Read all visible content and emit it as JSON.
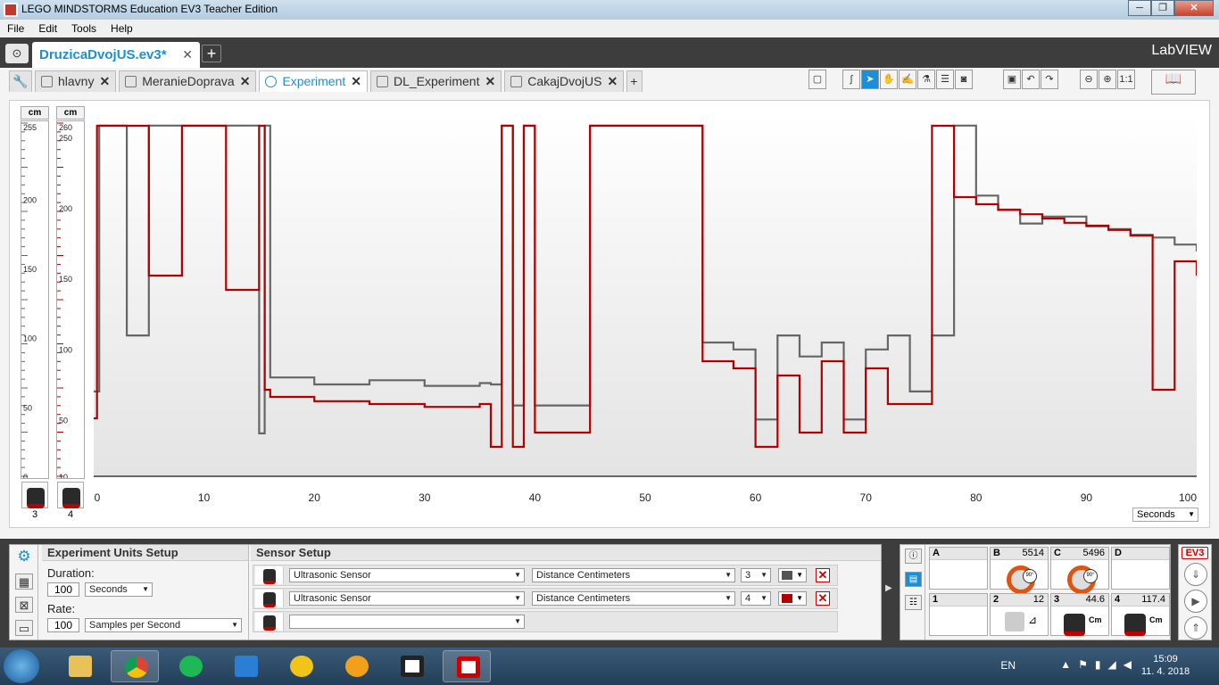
{
  "window": {
    "title": "LEGO MINDSTORMS Education EV3 Teacher Edition",
    "buttons": [
      "─",
      "❐",
      "✕"
    ]
  },
  "menu": [
    "File",
    "Edit",
    "Tools",
    "Help"
  ],
  "project": {
    "name": "DruzicaDvojUS.ev3*",
    "brand": "LabVIEW"
  },
  "program_tabs": [
    {
      "label": "hlavny"
    },
    {
      "label": "MeranieDoprava"
    },
    {
      "label": "Experiment"
    },
    {
      "label": "DL_Experiment"
    },
    {
      "label": "CakajDvojUS"
    }
  ],
  "chart": {
    "axis1": {
      "unit": "cm",
      "port": "3",
      "ticks": [
        "255",
        "200",
        "150",
        "100",
        "50",
        "0"
      ]
    },
    "axis2": {
      "unit": "cm",
      "port": "4",
      "ticks": [
        "260",
        "250",
        "200",
        "150",
        "100",
        "50",
        "10"
      ]
    },
    "time_unit": "Seconds"
  },
  "chart_data": {
    "type": "line",
    "xlabel": "Seconds",
    "xlim": [
      0,
      100
    ],
    "x_ticks": [
      0,
      10,
      20,
      30,
      40,
      50,
      60,
      70,
      80,
      90,
      100
    ],
    "series": [
      {
        "color": "#666666",
        "axis": "left",
        "ylim": [
          0,
          255
        ],
        "x": [
          0,
          0.5,
          1,
          2,
          3,
          5,
          10,
          14,
          15,
          15.5,
          16,
          20,
          25,
          30,
          35,
          36,
          37,
          38,
          39,
          40,
          45,
          50,
          55,
          55.2,
          58,
          60,
          62,
          64,
          66,
          68,
          70,
          72,
          74,
          76,
          78,
          80,
          82,
          84,
          86,
          88,
          90,
          92,
          94,
          96,
          98,
          100
        ],
        "y": [
          60,
          250,
          250,
          250,
          100,
          250,
          250,
          250,
          30,
          250,
          70,
          65,
          68,
          64,
          66,
          65,
          250,
          50,
          250,
          50,
          250,
          250,
          250,
          95,
          90,
          40,
          100,
          85,
          95,
          40,
          90,
          100,
          60,
          100,
          250,
          200,
          190,
          180,
          185,
          185,
          178,
          176,
          172,
          170,
          165,
          160
        ]
      },
      {
        "color": "#b00000",
        "axis": "right",
        "ylim": [
          10,
          260
        ],
        "x": [
          0,
          0.3,
          1,
          2,
          5,
          8,
          10,
          12,
          15,
          15.5,
          16,
          20,
          25,
          30,
          35,
          36,
          37,
          38,
          39,
          40,
          45,
          50,
          55,
          55.2,
          58,
          60,
          62,
          64,
          66,
          68,
          70,
          72,
          74,
          76,
          78,
          80,
          82,
          84,
          86,
          88,
          90,
          92,
          94,
          96,
          98,
          100
        ],
        "y": [
          50,
          255,
          255,
          255,
          150,
          255,
          255,
          140,
          255,
          70,
          65,
          62,
          60,
          58,
          60,
          30,
          255,
          30,
          255,
          40,
          255,
          255,
          255,
          90,
          85,
          30,
          80,
          40,
          90,
          40,
          85,
          60,
          60,
          255,
          205,
          200,
          196,
          193,
          190,
          187,
          185,
          182,
          178,
          70,
          160,
          150
        ]
      }
    ]
  },
  "experiment_setup": {
    "title": "Experiment Units Setup",
    "duration_label": "Duration:",
    "duration_value": "100",
    "duration_unit": "Seconds",
    "rate_label": "Rate:",
    "rate_value": "100",
    "rate_unit": "Samples per Second"
  },
  "sensor_setup": {
    "title": "Sensor Setup",
    "rows": [
      {
        "sensor": "Ultrasonic Sensor",
        "mode": "Distance Centimeters",
        "port": "3",
        "color": "#555555"
      },
      {
        "sensor": "Ultrasonic Sensor",
        "mode": "Distance Centimeters",
        "port": "4",
        "color": "#b00000"
      }
    ]
  },
  "hardware": {
    "ports": [
      {
        "port": "A",
        "value": ""
      },
      {
        "port": "B",
        "value": "5514"
      },
      {
        "port": "C",
        "value": "5496"
      },
      {
        "port": "D",
        "value": ""
      },
      {
        "port": "1",
        "value": ""
      },
      {
        "port": "2",
        "value": "12"
      },
      {
        "port": "3",
        "value": "44.6"
      },
      {
        "port": "4",
        "value": "117.4"
      }
    ],
    "ev3_logo": "EV3"
  },
  "tray": {
    "lang": "EN",
    "time": "15:09",
    "date": "11. 4. 2018"
  }
}
